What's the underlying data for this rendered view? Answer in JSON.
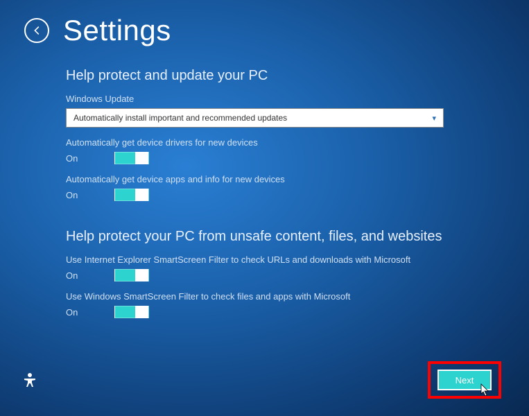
{
  "header": {
    "title": "Settings"
  },
  "section1": {
    "title": "Help protect and update your PC",
    "windows_update_label": "Windows Update",
    "windows_update_value": "Automatically install important and recommended updates",
    "drivers_label": "Automatically get device drivers for new devices",
    "drivers_state": "On",
    "apps_label": "Automatically get device apps and info for new devices",
    "apps_state": "On"
  },
  "section2": {
    "title": "Help protect your PC from unsafe content, files, and websites",
    "ie_smartscreen_label": "Use Internet Explorer SmartScreen Filter to check URLs and downloads with Microsoft",
    "ie_smartscreen_state": "On",
    "win_smartscreen_label": "Use Windows SmartScreen Filter to check files and apps with Microsoft",
    "win_smartscreen_state": "On"
  },
  "footer": {
    "next_label": "Next"
  }
}
